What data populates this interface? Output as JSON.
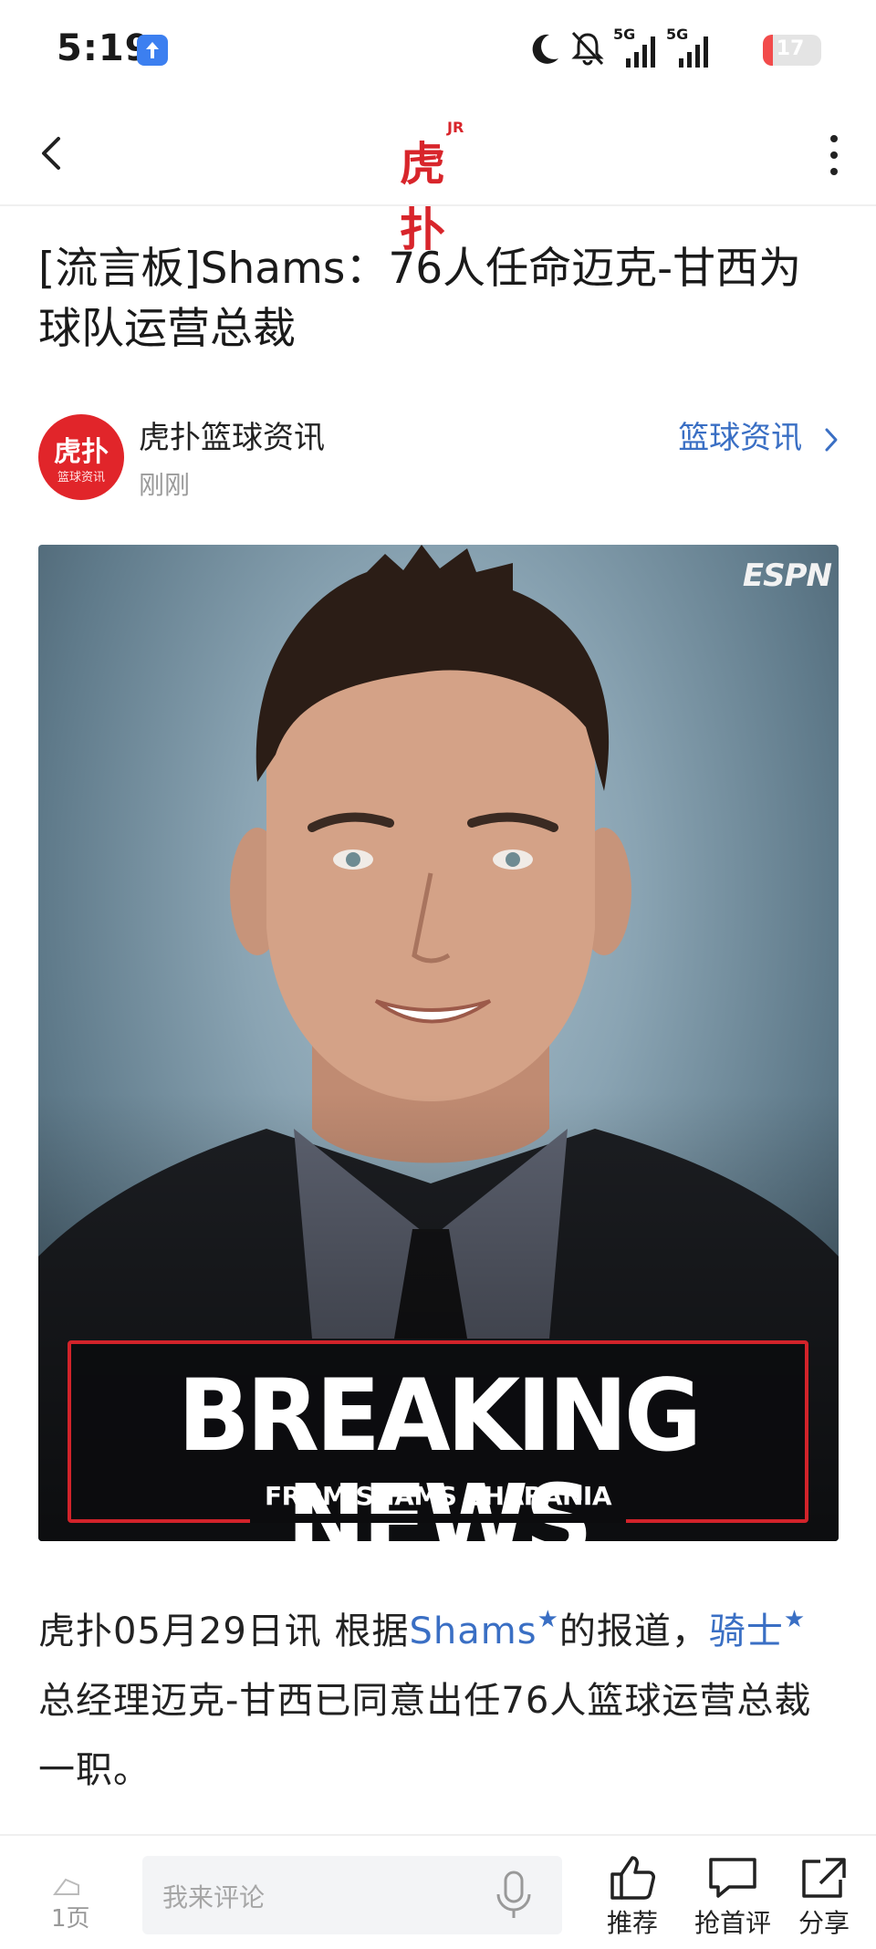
{
  "status_bar": {
    "time": "5:19",
    "battery": "17",
    "battery_level": 0.17,
    "signal1": "5G",
    "signal2": "5G"
  },
  "header": {
    "logo": "虎扑",
    "logo_sup": "JR"
  },
  "article": {
    "title": "[流言板]Shams：76人任命迈克-甘西为球队运营总裁",
    "author": "虎扑篮球资讯",
    "author_avatar_text": "虎扑",
    "author_avatar_sub": "篮球资讯",
    "time": "刚刚",
    "category": "篮球资讯"
  },
  "image": {
    "espn": "ESPN",
    "breaking": "BREAKING NEWS",
    "from": "FROM SHAMS CHARANIA"
  },
  "body": {
    "p1_a": "虎扑05月29日讯 根据",
    "p1_link1": "Shams",
    "p1_b": "的报道，",
    "p1_link2": "骑士",
    "p1_c": "总经理迈克-甘西已同意出任76人篮球运营总裁一职。"
  },
  "bottom_bar": {
    "page_count": "1页",
    "comment_placeholder": "我来评论",
    "recommend": "推荐",
    "first_comment": "抢首评",
    "share": "分享"
  },
  "colors": {
    "brand_red": "#d8252b",
    "link_blue": "#3a6fc4"
  }
}
